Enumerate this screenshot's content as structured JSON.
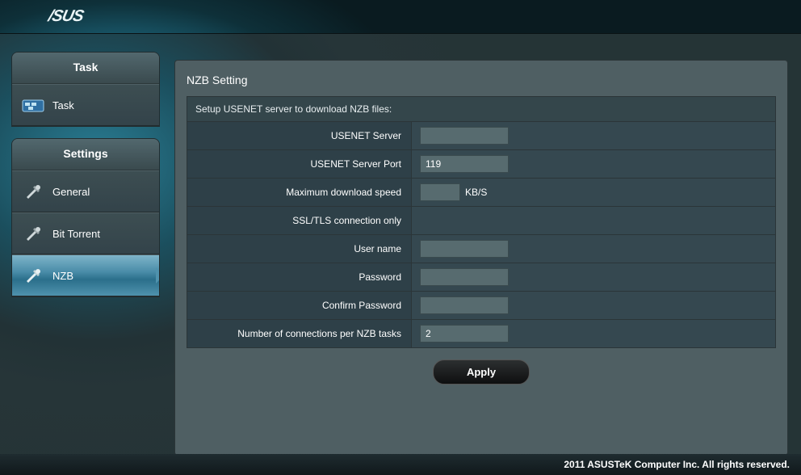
{
  "brand": "/SUS",
  "sidebar": {
    "task_header": "Task",
    "task_items": [
      {
        "label": "Task"
      }
    ],
    "settings_header": "Settings",
    "settings_items": [
      {
        "label": "General"
      },
      {
        "label": "Bit Torrent"
      },
      {
        "label": "NZB"
      }
    ]
  },
  "panel": {
    "title": "NZB Setting",
    "caption": "Setup USENET server to download NZB files:",
    "rows": {
      "usenet_server": {
        "label": "USENET Server",
        "value": ""
      },
      "usenet_port": {
        "label": "USENET Server Port",
        "value": "119"
      },
      "max_speed": {
        "label": "Maximum download speed",
        "value": "",
        "unit": "KB/S"
      },
      "ssl_only": {
        "label": "SSL/TLS connection only"
      },
      "username": {
        "label": "User name",
        "value": ""
      },
      "password": {
        "label": "Password",
        "value": ""
      },
      "confirm_password": {
        "label": "Confirm Password",
        "value": ""
      },
      "connections": {
        "label": "Number of connections per NZB tasks",
        "value": "2"
      }
    },
    "apply_label": "Apply"
  },
  "footer": "2011 ASUSTeK Computer Inc. All rights reserved."
}
